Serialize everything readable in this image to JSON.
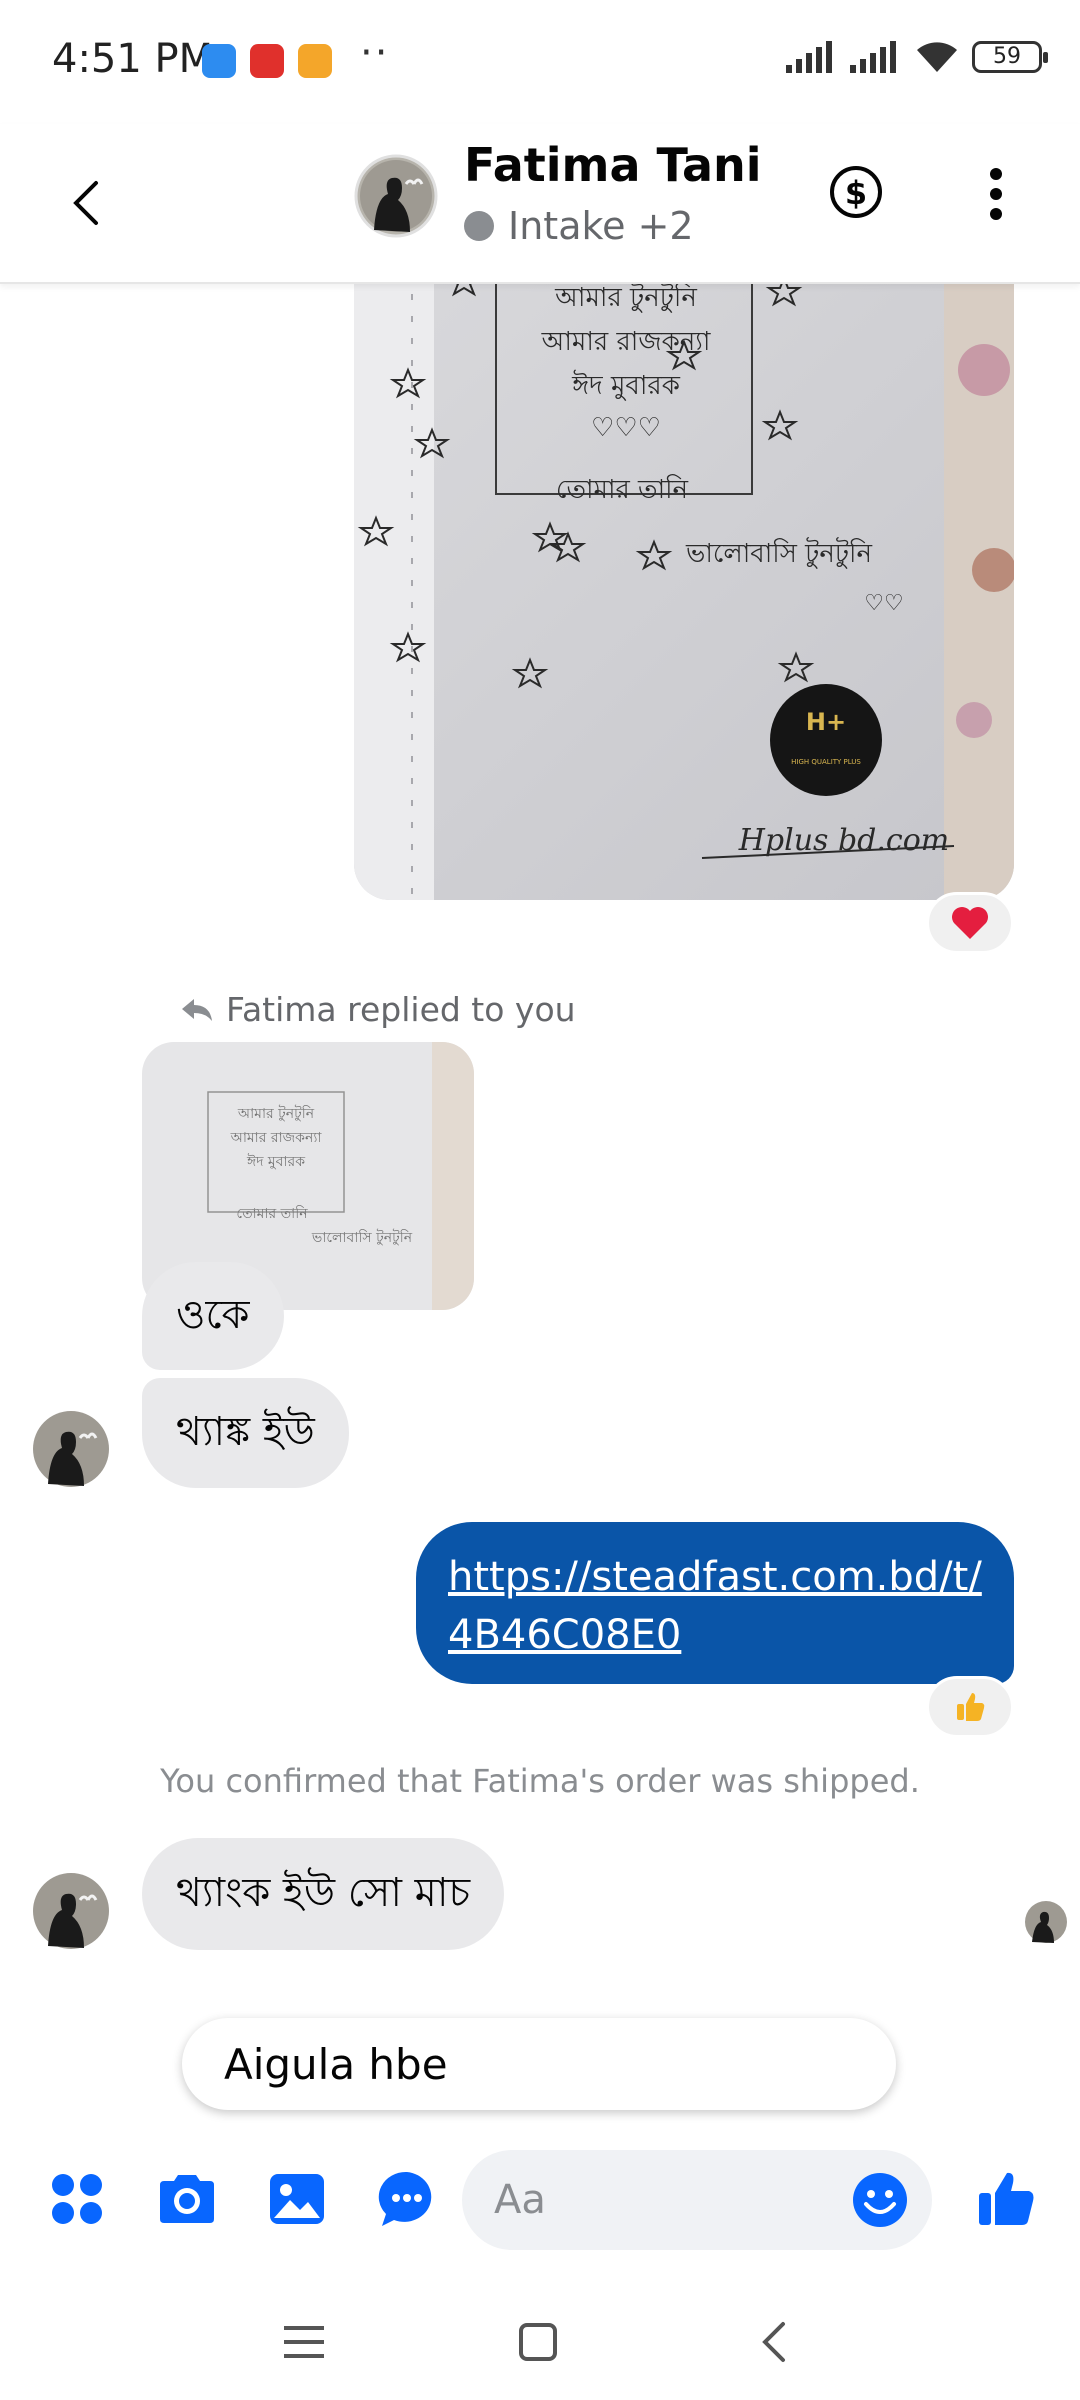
{
  "status_bar": {
    "time": "4:51 PM",
    "more_dots": "··",
    "battery": "59",
    "notification_icons": [
      "messenger-icon",
      "news-app-icon",
      "notes-app-icon"
    ]
  },
  "header": {
    "name": "Fatima Tani",
    "label": "Intake +2",
    "label_dot_color": "#8a8d91"
  },
  "messages": {
    "reply_label": "Fatima replied to you",
    "incoming_1": "ওকে",
    "incoming_2": "থ্যাঙ্ক ইউ",
    "outgoing_link": "https://steadfast.com.bd/t/4B46C08E0",
    "system_note": "You confirmed that Fatima's order was shipped.",
    "incoming_3": "থ্যাংক ইউ সো মাচ",
    "reaction_1": "heart",
    "reaction_2": "thumbs-up"
  },
  "photo": {
    "lines": [
      "আমার টুনটুনি",
      "আমার রাজকন্যা",
      "ঈদ মুবারক",
      "♡♡♡",
      "তোমার তানি",
      "ভালোবাসি টুনটুনি",
      "♡♡"
    ],
    "logo_text": "H+",
    "logo_sub": "HIGH QUALITY PLUS",
    "watermark": "Hplus bd.com"
  },
  "suggestion": "Aigula hbe",
  "composer": {
    "placeholder": "Aa"
  },
  "colors": {
    "accent": "#0866ff",
    "outgoing_bubble": "#0a55a8",
    "incoming_bubble": "#e9e9eb"
  }
}
